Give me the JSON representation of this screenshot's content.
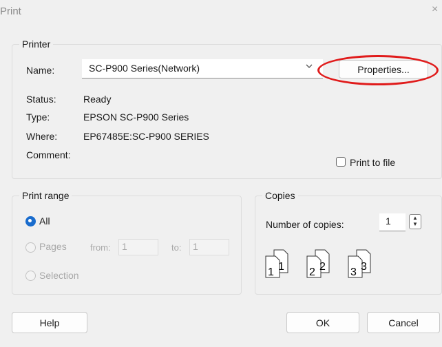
{
  "window": {
    "title": "Print",
    "close_glyph": "×"
  },
  "printer": {
    "legend": "Printer",
    "name_label": "Name:",
    "name_value": "SC-P900 Series(Network)",
    "properties_button": "Properties...",
    "status_label": "Status:",
    "status_value": "Ready",
    "type_label": "Type:",
    "type_value": "EPSON SC-P900 Series",
    "where_label": "Where:",
    "where_value": "EP67485E:SC-P900 SERIES",
    "comment_label": "Comment:",
    "print_to_file": "Print to file",
    "print_to_file_checked": false
  },
  "print_range": {
    "legend": "Print range",
    "all_label": "All",
    "pages_label": "Pages",
    "from_label": "from:",
    "from_value": "1",
    "to_label": "to:",
    "to_value": "1",
    "selection_label": "Selection",
    "selected": "all"
  },
  "copies": {
    "legend": "Copies",
    "number_label": "Number of copies:",
    "number_value": "1",
    "collate_pages": [
      "1",
      "2",
      "3"
    ]
  },
  "footer": {
    "help_button": "Help",
    "ok_button": "OK",
    "cancel_button": "Cancel"
  },
  "colors": {
    "accent": "#1a6ccd",
    "annotation": "#e01b1b",
    "dialog_bg": "#f0f0f0"
  },
  "icons": {
    "close": "close-icon",
    "dropdown": "chevron-down-icon",
    "spinner": "spinner-updown-icon",
    "collate": "collate-pages-icon"
  }
}
